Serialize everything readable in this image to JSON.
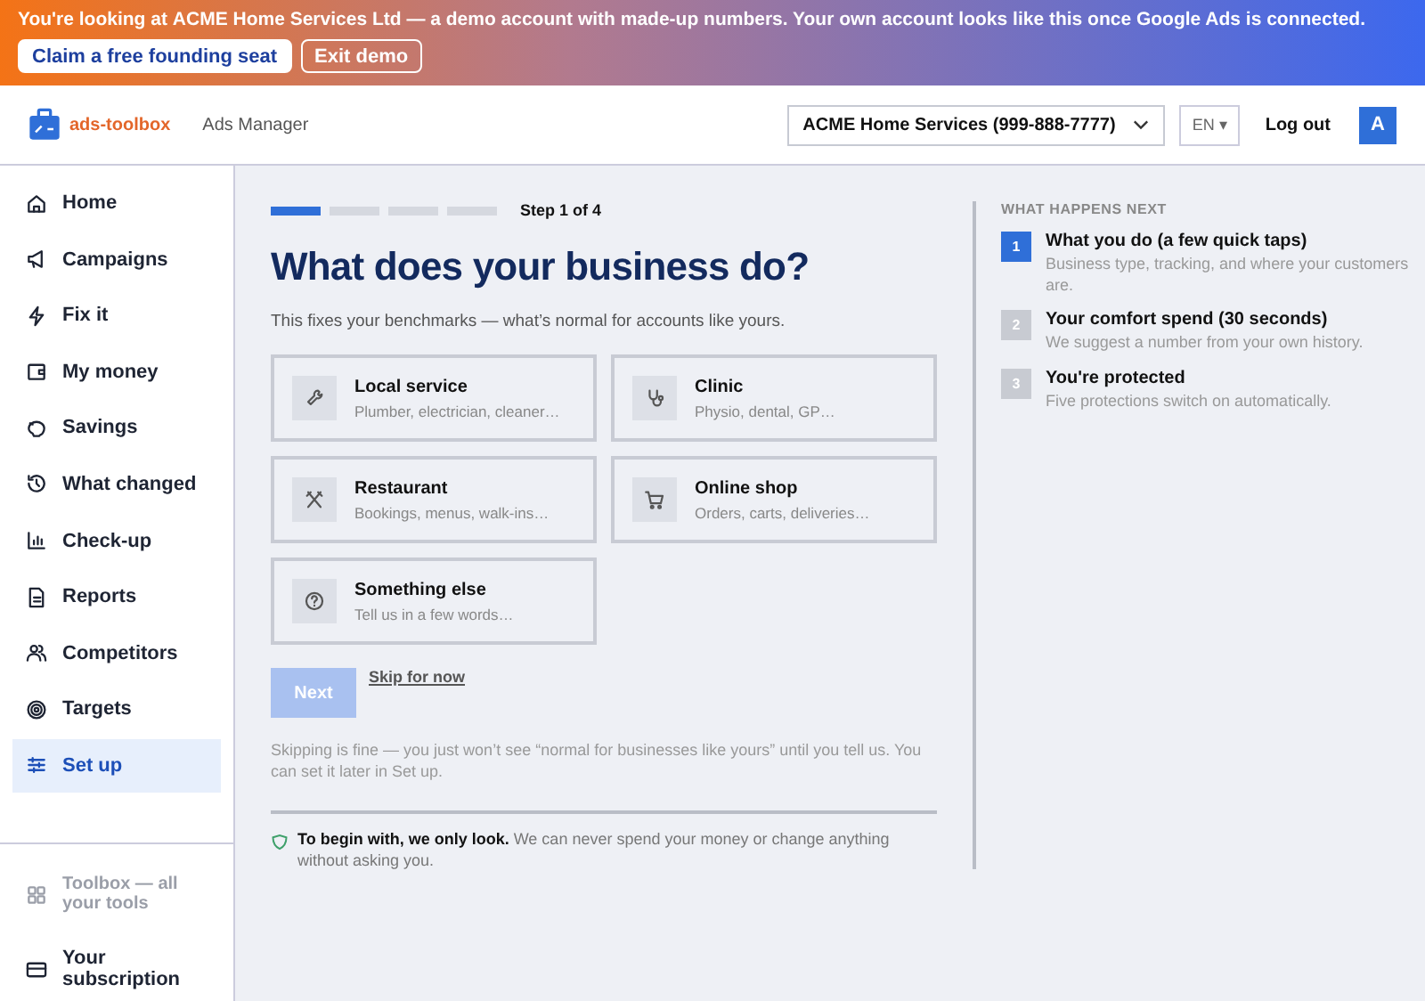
{
  "banner": {
    "message": "You're looking at **ACME Home Services Ltd** — a demo account with made-up numbers. Your own account looks like this once Google Ads is connected.",
    "buttons": [
      {
        "label": "Claim a free founding seat",
        "kind": "primary"
      },
      {
        "label": "Exit demo",
        "kind": "outline"
      }
    ]
  },
  "header": {
    "logo": "ads-toolbox",
    "product": "Ads Manager",
    "account": "ACME Home Services (999-888-7777)",
    "language": "EN ▾",
    "logout": "Log out",
    "avatar": "A"
  },
  "sidebar": {
    "items": [
      {
        "label": "Home",
        "selected": false
      },
      {
        "label": "Campaigns",
        "selected": false
      },
      {
        "label": "Fix it",
        "selected": false
      },
      {
        "label": "My money",
        "selected": false
      },
      {
        "label": "Savings",
        "selected": false
      },
      {
        "label": "What changed",
        "selected": false
      },
      {
        "label": "Check-up",
        "selected": false
      },
      {
        "label": "Reports",
        "selected": false
      },
      {
        "label": "Competitors",
        "selected": false
      },
      {
        "label": "Targets",
        "selected": false
      },
      {
        "label": "Set up",
        "selected": true
      }
    ],
    "footer": [
      {
        "label": "Toolbox — all your tools",
        "disabled": true
      },
      {
        "label": "Your subscription",
        "disabled": false
      }
    ]
  },
  "wizard": {
    "steps": [
      {
        "done": true
      },
      {
        "done": false
      },
      {
        "done": false
      },
      {
        "done": false
      }
    ],
    "step_label": "Step 1 of 4",
    "title": "What does your business do?",
    "subtitle": "This fixes your benchmarks — what’s normal for accounts like yours.",
    "options": [
      {
        "title": "Local service",
        "hint": "Plumber, electrician, cleaner…",
        "selected": false
      },
      {
        "title": "Clinic",
        "hint": "Physio, dental, GP…",
        "selected": false
      },
      {
        "title": "Restaurant",
        "hint": "Bookings, menus, walk-ins…",
        "selected": false
      },
      {
        "title": "Online shop",
        "hint": "Orders, carts, deliveries…",
        "selected": false
      },
      {
        "title": "Something else",
        "hint": "Tell us in a few words…",
        "selected": false
      }
    ],
    "next": {
      "label": "Next",
      "disabled": true
    },
    "skip": "Skip for now",
    "skip_note": "Skipping is fine — you just won’t see “normal for businesses like yours” until you tell us. You can set it later in Set up.",
    "reassurance": "**To begin with, we only look.** We can never spend your money or change anything without asking you."
  },
  "next_panel": {
    "heading": "WHAT HAPPENS NEXT",
    "steps": [
      {
        "number": "1",
        "title": "What you do (a few quick taps)",
        "text": "Business type, tracking, and where your customers are.",
        "active": true
      },
      {
        "number": "2",
        "title": "Your comfort spend (30 seconds)",
        "text": "We suggest a number from your own history.",
        "active": false
      },
      {
        "number": "3",
        "title": "You're protected",
        "text": "Five protections switch on automatically.",
        "active": false
      }
    ]
  }
}
